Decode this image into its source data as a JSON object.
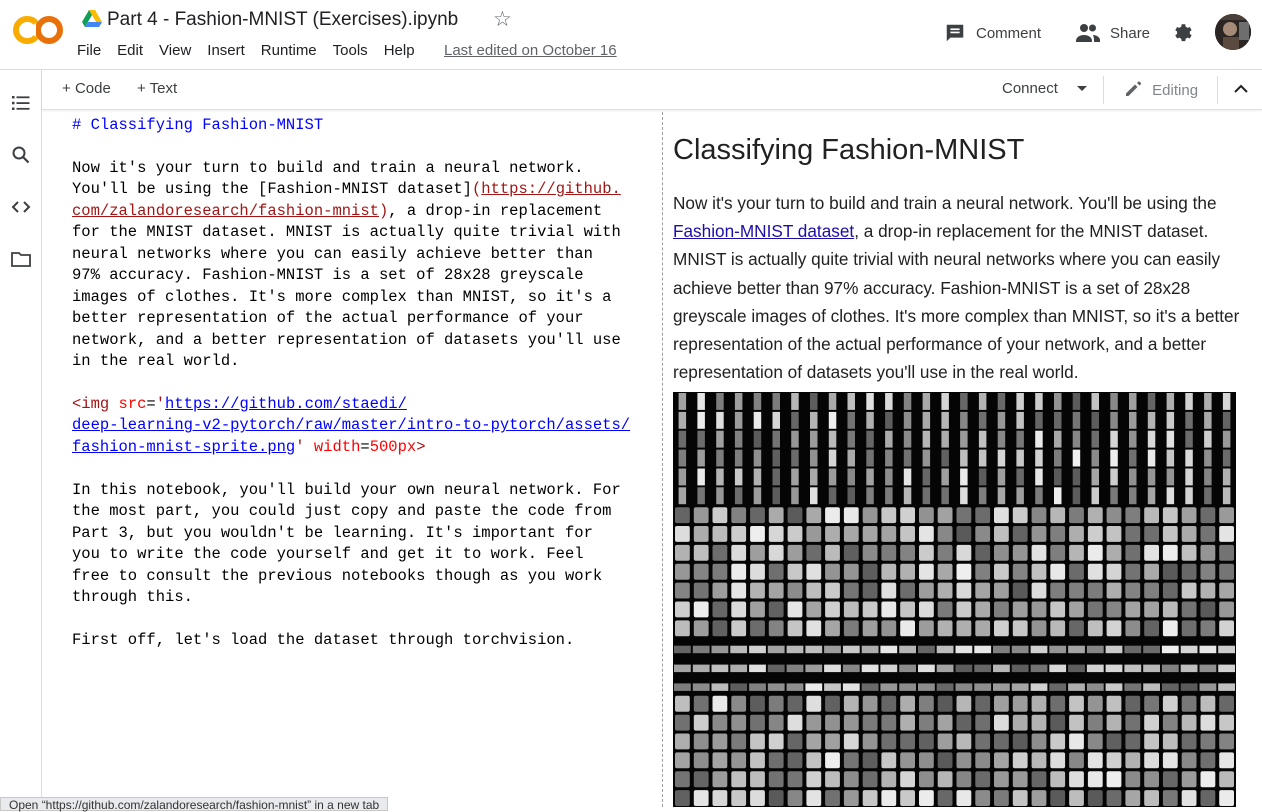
{
  "header": {
    "title": "Part 4 - Fashion-MNIST (Exercises).ipynb",
    "menu": [
      "File",
      "Edit",
      "View",
      "Insert",
      "Runtime",
      "Tools",
      "Help"
    ],
    "last_edited": "Last edited on October 16",
    "comment_label": "Comment",
    "share_label": "Share",
    "brand_color": "#f9ab00"
  },
  "toolbar": {
    "add_code": "Code",
    "add_text": "Text",
    "connect": "Connect",
    "editing": "Editing"
  },
  "editor": {
    "heading": "# Classifying Fashion-MNIST",
    "p1_a": "Now it's your turn to build and train a neural network.\nYou'll be using the ",
    "p1_link_text": "[Fashion-MNIST dataset]",
    "p1_link_open": "(",
    "p1_link_url": "https://github.\ncom/zalandoresearch/fashion-mnist",
    "p1_link_close": ")",
    "p1_b": ", a drop-in replacement\nfor the MNIST dataset. MNIST is actually quite trivial with\nneural networks where you can easily achieve better than\n97% accuracy. Fashion-MNIST is a set of 28x28 greyscale\nimages of clothes. It's more complex than MNIST, so it's a\nbetter representation of the actual performance of your\nnetwork, and a better representation of datasets you'll use\nin the real world.",
    "img_tag_open": "<img ",
    "img_src_attr": "src",
    "img_eq": "=",
    "img_quote": "'",
    "img_src_url": "https://github.com/staedi/\ndeep-learning-v2-pytorch/raw/master/intro-to-pytorch/assets/\nfashion-mnist-sprite.png",
    "img_width_attr": "width",
    "img_width_val": "500px",
    "img_tag_close": ">",
    "p2": "In this notebook, you'll build your own neural network. For\nthe most part, you could just copy and paste the code from\nPart 3, but you wouldn't be learning. It's important for\nyou to write the code yourself and get it to work. Feel\nfree to consult the previous notebooks though as you work\nthrough this.",
    "p3": "First off, let's load the dataset through torchvision."
  },
  "preview": {
    "heading": "Classifying Fashion-MNIST",
    "p1_a": "Now it's your turn to build and train a neural network. You'll be using the ",
    "p1_link": "Fashion-MNIST dataset",
    "p1_b": ", a drop-in replacement for the MNIST dataset. MNIST is actually quite trivial with neural networks where you can easily achieve better than 97% accuracy. Fashion-MNIST is a set of 28x28 greyscale images of clothes. It's more complex than MNIST, so it's a better representation of the actual performance of your network, and a better representation of datasets you'll use in the real world."
  },
  "status": {
    "hover_text": "Open “https://github.com/zalandoresearch/fashion-mnist” in a new tab"
  }
}
